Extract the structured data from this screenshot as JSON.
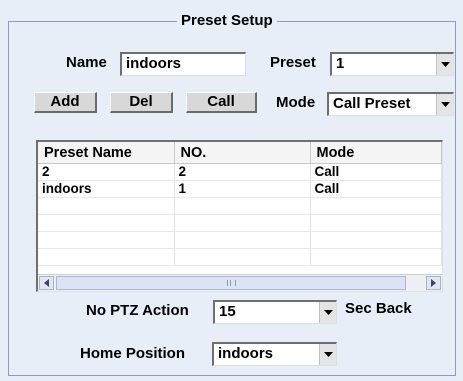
{
  "window": {
    "legend": "Preset Setup"
  },
  "form": {
    "name_label": "Name",
    "name_value": "indoors",
    "preset_label": "Preset",
    "preset_value": "1",
    "mode_label": "Mode",
    "mode_value": "Call Preset"
  },
  "buttons": {
    "add": "Add",
    "del": "Del",
    "call": "Call"
  },
  "table": {
    "columns": [
      "Preset Name",
      "NO.",
      "Mode"
    ],
    "rows": [
      [
        "2",
        "2",
        "Call"
      ],
      [
        "indoors",
        "1",
        "Call"
      ],
      [
        "",
        "",
        ""
      ],
      [
        "",
        "",
        ""
      ],
      [
        "",
        "",
        ""
      ],
      [
        "",
        "",
        ""
      ]
    ]
  },
  "ptz": {
    "label": "No PTZ Action",
    "value": "15",
    "suffix": "Sec Back"
  },
  "home": {
    "label": "Home Position",
    "value": "indoors"
  },
  "icons": {
    "dropdown": "chevron-down-icon",
    "scroll_left": "arrow-left-icon",
    "scroll_right": "arrow-right-icon",
    "grip": "scroll-grip-icon"
  }
}
